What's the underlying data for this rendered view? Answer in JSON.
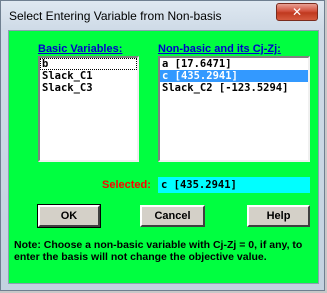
{
  "window": {
    "title": "Select Entering Variable from Non-basis",
    "close_glyph": "✕"
  },
  "basic": {
    "label": "Basic Variables:",
    "items": [
      "b",
      "Slack_C1",
      "Slack_C3"
    ]
  },
  "nonbasic": {
    "label": "Non-basic and its Cj-Zj:",
    "items": [
      "a [17.6471]",
      "c [435.2941]",
      "Slack_C2 [-123.5294]"
    ],
    "selected_index": 1
  },
  "selection": {
    "label": "Selected:",
    "value": "c [435.2941]"
  },
  "buttons": {
    "ok": "OK",
    "cancel": "Cancel",
    "help": "Help"
  },
  "note": {
    "text": "Note:  Choose a non-basic variable with Cj-Zj = 0, if any, to enter the basis will not change the objective value."
  },
  "colors": {
    "client_bg": "#00ff40",
    "label_blue": "#0000cc",
    "selected_red": "#ff0000",
    "selected_box": "#00ffff",
    "list_highlight": "#3399ff"
  }
}
